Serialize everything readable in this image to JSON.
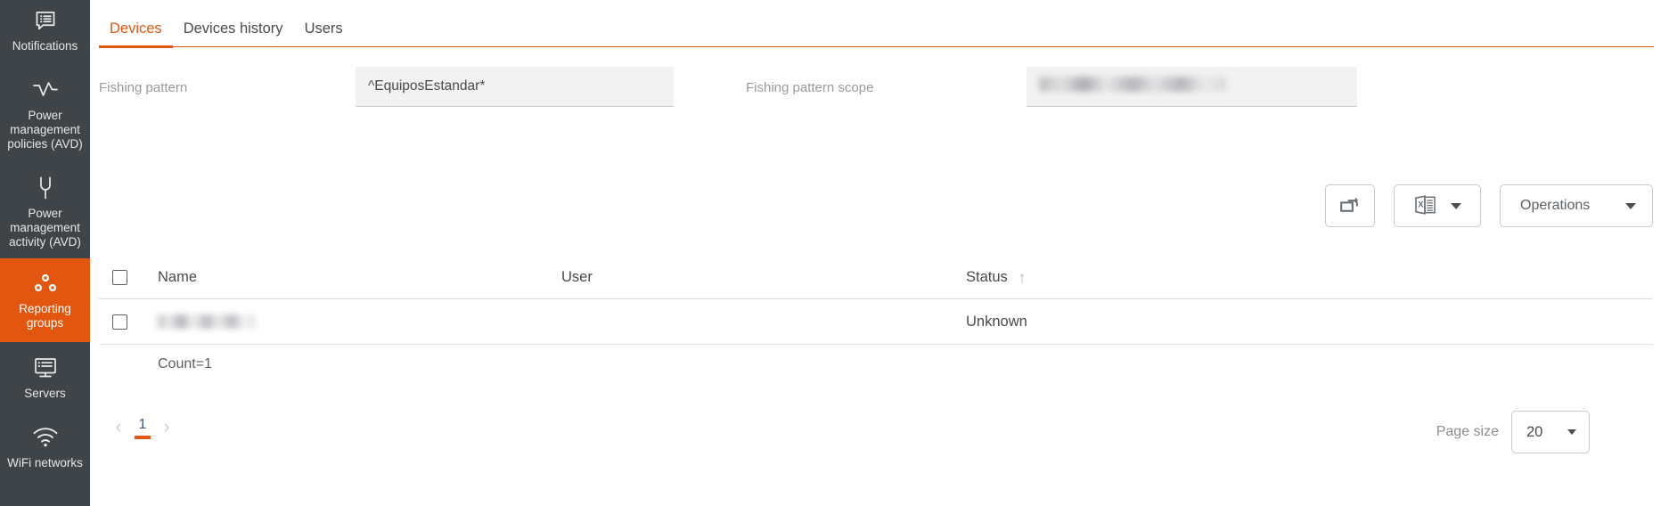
{
  "sidebar": {
    "background_color": "#3f4448",
    "active_color": "#e2560f",
    "items": [
      {
        "id": "notifications",
        "label": "Notifications",
        "icon": "notifications-icon",
        "active": false
      },
      {
        "id": "power-policies",
        "label": "Power management policies (AVD)",
        "icon": "activity-pulse-icon",
        "active": false
      },
      {
        "id": "power-activity",
        "label": "Power management activity (AVD)",
        "icon": "power-plug-icon",
        "active": false
      },
      {
        "id": "reporting-groups",
        "label": "Reporting groups",
        "icon": "reporting-groups-icon",
        "active": true
      },
      {
        "id": "servers",
        "label": "Servers",
        "icon": "server-monitor-icon",
        "active": false
      },
      {
        "id": "wifi",
        "label": "WiFi networks",
        "icon": "wifi-icon",
        "active": false
      }
    ]
  },
  "tabs": [
    {
      "id": "devices",
      "label": "Devices",
      "active": true
    },
    {
      "id": "devices-history",
      "label": "Devices history",
      "active": false
    },
    {
      "id": "users",
      "label": "Users",
      "active": false
    }
  ],
  "filters": {
    "pattern": {
      "label": "Fishing pattern",
      "value": "^EquiposEstandar*",
      "placeholder": ""
    },
    "scope": {
      "label": "Fishing pattern scope",
      "value": "",
      "placeholder": "",
      "redacted": true
    }
  },
  "toolbar": {
    "reset_button": {
      "label": "",
      "icon": "reset-window-icon"
    },
    "excel_button": {
      "label": "",
      "icon": "excel-export-icon",
      "caret": "chevron-down-icon"
    },
    "operations_button": {
      "label": "Operations",
      "caret": "chevron-down-icon"
    }
  },
  "table": {
    "select_all": {
      "checked": false
    },
    "columns": [
      {
        "id": "name",
        "label": "Name",
        "sort": ""
      },
      {
        "id": "user",
        "label": "User",
        "sort": ""
      },
      {
        "id": "status",
        "label": "Status",
        "sort": "asc",
        "sort_glyph": "↑"
      }
    ],
    "rows": [
      {
        "checked": false,
        "name": "",
        "name_redacted": true,
        "user": "",
        "status": "Unknown"
      }
    ],
    "count_text": "Count=1"
  },
  "pagination": {
    "prev_glyph": "‹",
    "next_glyph": "›",
    "pages": [
      {
        "label": "1",
        "active": true
      }
    ],
    "page_size_label": "Page size",
    "page_size_value": "20",
    "page_size_options": [
      "20"
    ]
  },
  "theme": {
    "accent": "#e2560f",
    "text": "#4a4a4a",
    "muted": "#9a9a9a",
    "border": "#dcdcdc",
    "input_bg": "#f2f2f2"
  }
}
